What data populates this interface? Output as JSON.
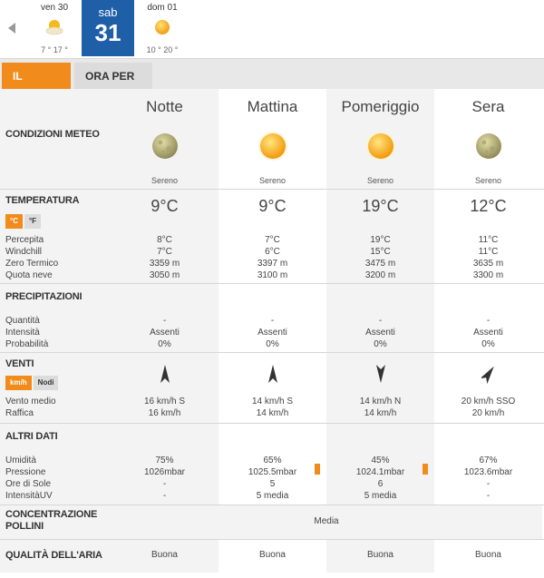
{
  "days": [
    {
      "name": "ven 30",
      "temps": "7 ° 17 °",
      "icon": "sun-cloud-icon"
    },
    {
      "name": "sab",
      "number": "31",
      "icon": "none"
    },
    {
      "name": "dom 01",
      "temps": "10 ° 20 °",
      "icon": "sun-icon"
    }
  ],
  "tabs": {
    "day": "IL GIORNO",
    "hourly": "ORA PER ORA"
  },
  "periods": [
    "Notte",
    "Mattina",
    "Pomeriggio",
    "Sera"
  ],
  "conditions": {
    "label": "CONDIZIONI METEO",
    "values": [
      "Sereno",
      "Sereno",
      "Sereno",
      "Sereno"
    ],
    "icons": [
      "moon-icon",
      "sun-icon",
      "sun-icon",
      "moon-icon"
    ]
  },
  "temperature": {
    "label": "TEMPERATURA",
    "unit_c": "°C",
    "unit_f": "°F",
    "values": [
      "9°C",
      "9°C",
      "19°C",
      "12°C"
    ],
    "sublabels": [
      "Percepita",
      "Windchill",
      "Zero Termico",
      "Quota neve"
    ],
    "details": [
      [
        "8°C",
        "7°C",
        "3359 m",
        "3050 m"
      ],
      [
        "7°C",
        "6°C",
        "3397 m",
        "3100 m"
      ],
      [
        "19°C",
        "15°C",
        "3475 m",
        "3200 m"
      ],
      [
        "11°C",
        "11°C",
        "3635 m",
        "3300 m"
      ]
    ]
  },
  "precipitation": {
    "label": "PRECIPITAZIONI",
    "sublabels": [
      "Quantità",
      "Intensità",
      "Probabilità"
    ],
    "details": [
      [
        "-",
        "Assenti",
        "0%"
      ],
      [
        "-",
        "Assenti",
        "0%"
      ],
      [
        "-",
        "Assenti",
        "0%"
      ],
      [
        "-",
        "Assenti",
        "0%"
      ]
    ]
  },
  "wind": {
    "label": "VENTI",
    "unit_kmh": "km/h",
    "unit_knots": "Nodi",
    "sublabels": [
      "Vento medio",
      "Raffica"
    ],
    "directions": [
      "north-arrow-icon",
      "north-arrow-icon",
      "south-arrow-icon",
      "northeast-arrow-icon"
    ],
    "details": [
      [
        "16 km/h  S",
        "16 km/h"
      ],
      [
        "14 km/h S",
        "14 km/h"
      ],
      [
        "14 km/h N",
        "14 km/h"
      ],
      [
        "20 km/h SSO",
        "20 km/h"
      ]
    ]
  },
  "other": {
    "label": "ALTRI DATI",
    "sublabels": [
      "Umidità",
      "Pressione",
      "Ore di Sole",
      "IntensitàUV"
    ],
    "details": [
      [
        "75%",
        "1026mbar",
        "-",
        "-"
      ],
      [
        "65%",
        "1025.5mbar",
        "5",
        "5 media"
      ],
      [
        "45%",
        "1024.1mbar",
        "6",
        "5 media"
      ],
      [
        "67%",
        "1023.6mbar",
        "-",
        "-"
      ]
    ],
    "uv_level": [
      null,
      5,
      5,
      null
    ]
  },
  "pollen": {
    "label_1": "CONCENTRAZIONE",
    "label_2": "POLLINI",
    "value": "Media"
  },
  "air": {
    "label": "QUALITÀ DELL'ARIA",
    "values": [
      "Buona",
      "Buona",
      "Buona",
      "Buona"
    ]
  },
  "colors": {
    "accent": "#f18c1c",
    "active_day": "#1e5fa8",
    "label_bg": "#f3f3f3"
  }
}
